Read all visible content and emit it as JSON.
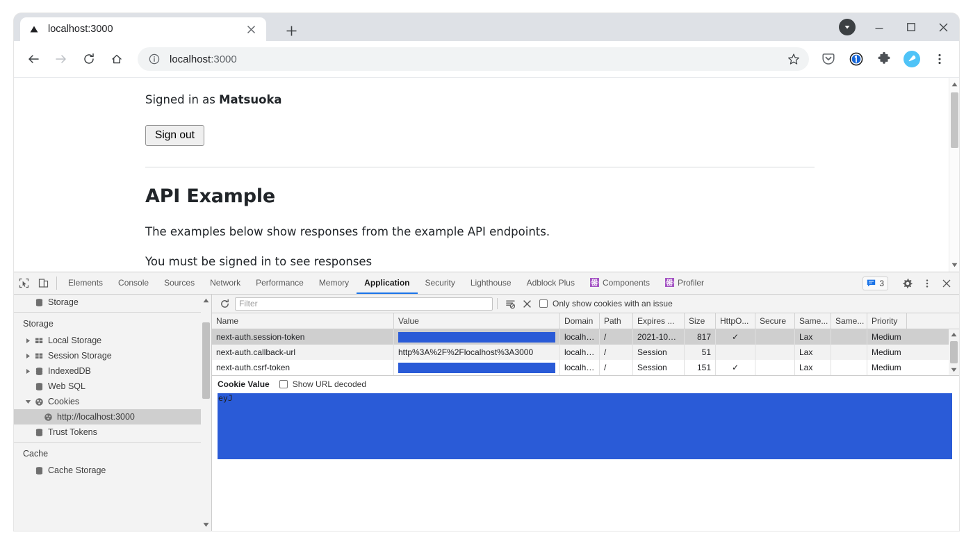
{
  "browser": {
    "tab": {
      "title": "localhost:3000",
      "favicon": "triangle-favicon",
      "close_icon": "close-icon"
    },
    "new_tab_label": "+",
    "window_controls": {
      "profile": "profile-avatar-icon",
      "minimize": "minimize-icon",
      "maximize": "maximize-icon",
      "close": "window-close-icon"
    },
    "nav": {
      "back": "back-arrow-icon",
      "forward": "forward-arrow-icon",
      "reload": "reload-icon",
      "home": "home-icon"
    },
    "omnibox": {
      "info_icon": "site-info-icon",
      "url_host": "localhost",
      "url_port": ":3000",
      "bookmark_icon": "star-icon"
    },
    "extensions": [
      {
        "name": "pocket-icon"
      },
      {
        "name": "onepassword-icon"
      },
      {
        "name": "extensions-puzzle-icon"
      },
      {
        "name": "profile-avatar-icon"
      },
      {
        "name": "chrome-menu-icon"
      }
    ]
  },
  "page": {
    "signed_in_prefix": "Signed in as ",
    "signed_in_user": "Matsuoka",
    "sign_out_label": "Sign out",
    "heading": "API Example",
    "paragraph1": "The examples below show responses from the example API endpoints.",
    "paragraph2": "You must be signed in to see responses"
  },
  "devtools": {
    "left_icons": [
      {
        "name": "inspect-element-icon"
      },
      {
        "name": "device-toolbar-icon"
      }
    ],
    "tabs": [
      {
        "label": "Elements",
        "active": false,
        "icon": null
      },
      {
        "label": "Console",
        "active": false,
        "icon": null
      },
      {
        "label": "Sources",
        "active": false,
        "icon": null
      },
      {
        "label": "Network",
        "active": false,
        "icon": null
      },
      {
        "label": "Performance",
        "active": false,
        "icon": null
      },
      {
        "label": "Memory",
        "active": false,
        "icon": null
      },
      {
        "label": "Application",
        "active": true,
        "icon": null
      },
      {
        "label": "Security",
        "active": false,
        "icon": null
      },
      {
        "label": "Lighthouse",
        "active": false,
        "icon": null
      },
      {
        "label": "Adblock Plus",
        "active": false,
        "icon": null
      },
      {
        "label": "Components",
        "active": false,
        "icon": "react-icon"
      },
      {
        "label": "Profiler",
        "active": false,
        "icon": "react-icon"
      }
    ],
    "message_count": "3",
    "right_icons": [
      {
        "name": "settings-gear-icon"
      },
      {
        "name": "devtools-more-icon"
      },
      {
        "name": "devtools-close-icon"
      }
    ],
    "sidebar": {
      "top_item": {
        "label": "Storage",
        "icon": "database-icon"
      },
      "sections": [
        {
          "title": "Storage",
          "items": [
            {
              "label": "Local Storage",
              "icon": "table-icon",
              "arrow": "collapsed",
              "indent": 0,
              "selected": false
            },
            {
              "label": "Session Storage",
              "icon": "table-icon",
              "arrow": "collapsed",
              "indent": 0,
              "selected": false
            },
            {
              "label": "IndexedDB",
              "icon": "database-icon",
              "arrow": "collapsed",
              "indent": 0,
              "selected": false
            },
            {
              "label": "Web SQL",
              "icon": "database-icon",
              "arrow": "none",
              "indent": 0,
              "selected": false
            },
            {
              "label": "Cookies",
              "icon": "cookie-icon",
              "arrow": "expanded",
              "indent": 0,
              "selected": false
            },
            {
              "label": "http://localhost:3000",
              "icon": "cookie-icon",
              "arrow": "none",
              "indent": 1,
              "selected": true
            },
            {
              "label": "Trust Tokens",
              "icon": "database-icon",
              "arrow": "none",
              "indent": 0,
              "selected": false
            }
          ]
        },
        {
          "title": "Cache",
          "items": [
            {
              "label": "Cache Storage",
              "icon": "database-icon",
              "arrow": "none",
              "indent": 0,
              "selected": false
            }
          ]
        }
      ]
    },
    "cookie_toolbar": {
      "refresh_icon": "refresh-icon",
      "filter_placeholder": "Filter",
      "clear_filtered_icon": "clear-filtered-cookies-icon",
      "delete_icon": "delete-cookie-icon",
      "issue_filter_label": "Only show cookies with an issue",
      "issue_filter_checked": false
    },
    "cookie_table": {
      "columns": [
        "Name",
        "Value",
        "Domain",
        "Path",
        "Expires ...",
        "Size",
        "HttpO...",
        "Secure",
        "Same...",
        "Same...",
        "Priority"
      ],
      "rows": [
        {
          "name": "next-auth.session-token",
          "value": "",
          "value_redacted": true,
          "domain": "localh…",
          "path": "/",
          "expires": "2021-10…",
          "size": "817",
          "httponly": "✓",
          "secure": "",
          "samesite": "Lax",
          "sameparty": "",
          "priority": "Medium",
          "selected": true
        },
        {
          "name": "next-auth.callback-url",
          "value": "http%3A%2F%2Flocalhost%3A3000",
          "value_redacted": false,
          "domain": "localh…",
          "path": "/",
          "expires": "Session",
          "size": "51",
          "httponly": "",
          "secure": "",
          "samesite": "Lax",
          "sameparty": "",
          "priority": "Medium",
          "selected": false
        },
        {
          "name": "next-auth.csrf-token",
          "value": "",
          "value_redacted": true,
          "domain": "localh…",
          "path": "/",
          "expires": "Session",
          "size": "151",
          "httponly": "✓",
          "secure": "",
          "samesite": "Lax",
          "sameparty": "",
          "priority": "Medium",
          "selected": false
        }
      ]
    },
    "cookie_value_panel": {
      "title": "Cookie Value",
      "url_decoded_label": "Show URL decoded",
      "url_decoded_checked": false,
      "value_prefix": "eyJ",
      "value_redacted": true
    }
  },
  "colors": {
    "accent_blue": "#1a73e8",
    "redaction_blue": "#2a5bd7",
    "chrome_toolbar": "#dee1e6",
    "devtools_bg": "#f3f3f3",
    "react_purple": "#a454c3"
  }
}
